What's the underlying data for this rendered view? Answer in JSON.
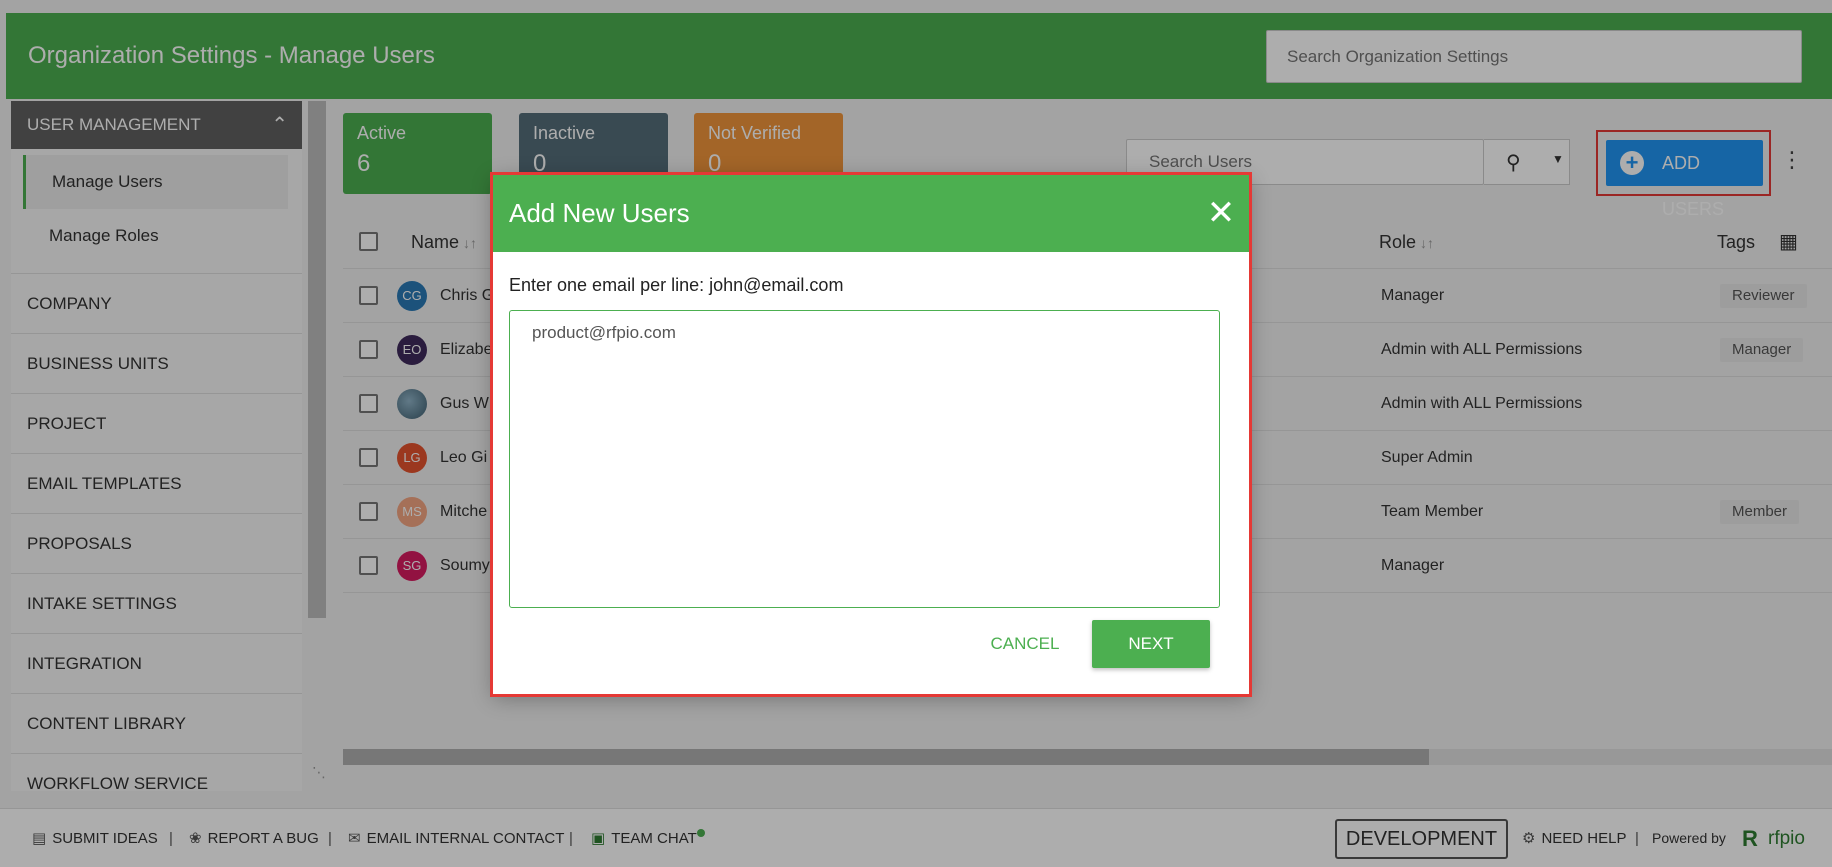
{
  "header": {
    "title": "Organization Settings - Manage Users",
    "search_placeholder": "Search Organization Settings"
  },
  "sidebar": {
    "section_label": "USER MANAGEMENT",
    "sub_items": [
      {
        "label": "Manage Users",
        "active": true
      },
      {
        "label": "Manage Roles",
        "active": false
      }
    ],
    "items": [
      {
        "label": "COMPANY"
      },
      {
        "label": "BUSINESS UNITS"
      },
      {
        "label": "PROJECT"
      },
      {
        "label": "EMAIL TEMPLATES"
      },
      {
        "label": "PROPOSALS"
      },
      {
        "label": "INTAKE SETTINGS"
      },
      {
        "label": "INTEGRATION"
      },
      {
        "label": "CONTENT LIBRARY"
      },
      {
        "label": "WORKFLOW SERVICE"
      }
    ]
  },
  "stats": {
    "active": {
      "label": "Active",
      "count": "6"
    },
    "inactive": {
      "label": "Inactive",
      "count": "0"
    },
    "not_verified": {
      "label": "Not Verified",
      "count": "0"
    }
  },
  "toolbar": {
    "search_placeholder": "Search Users",
    "add_users_label": "ADD USERS"
  },
  "table": {
    "headers": {
      "name": "Name",
      "role": "Role",
      "tags": "Tags"
    },
    "rows": [
      {
        "initials": "CG",
        "name": "Chris G",
        "role": "Manager",
        "tag": "Reviewer",
        "avatar_color": "#2a7ab5"
      },
      {
        "initials": "EO",
        "name": "Elizabe",
        "role": "Admin with ALL Permissions",
        "tag": "Manager",
        "avatar_color": "#3f2a5c"
      },
      {
        "initials": "",
        "name": "Gus W",
        "role": "Admin with ALL Permissions",
        "tag": "",
        "avatar_color": "#4a6b7a"
      },
      {
        "initials": "LG",
        "name": "Leo Gi",
        "role": "Super Admin",
        "tag": "",
        "avatar_color": "#e5532f"
      },
      {
        "initials": "MS",
        "name": "Mitche",
        "role": "Team Member",
        "tag": "Member",
        "avatar_color": "#f4a582"
      },
      {
        "initials": "SG",
        "name": "Soumy",
        "role": "Manager",
        "tag": "",
        "avatar_color": "#d81b60"
      }
    ]
  },
  "modal": {
    "title": "Add New Users",
    "instruction": "Enter one email per line: john@email.com",
    "textarea_value": "product@rfpio.com",
    "cancel_label": "CANCEL",
    "next_label": "NEXT"
  },
  "footer": {
    "submit_ideas": "SUBMIT IDEAS",
    "report_bug": "REPORT A BUG",
    "email_contact": "EMAIL INTERNAL CONTACT",
    "team_chat": "TEAM CHAT",
    "environment": "DEVELOPMENT",
    "need_help": "NEED HELP",
    "powered_by": "Powered by",
    "brand": "rfpio"
  },
  "colors": {
    "primary_green": "#4caf50",
    "accent_blue": "#2196f3",
    "highlight_red": "#e53935",
    "inactive_slate": "#546e7a",
    "warning_orange": "#f0963c"
  }
}
